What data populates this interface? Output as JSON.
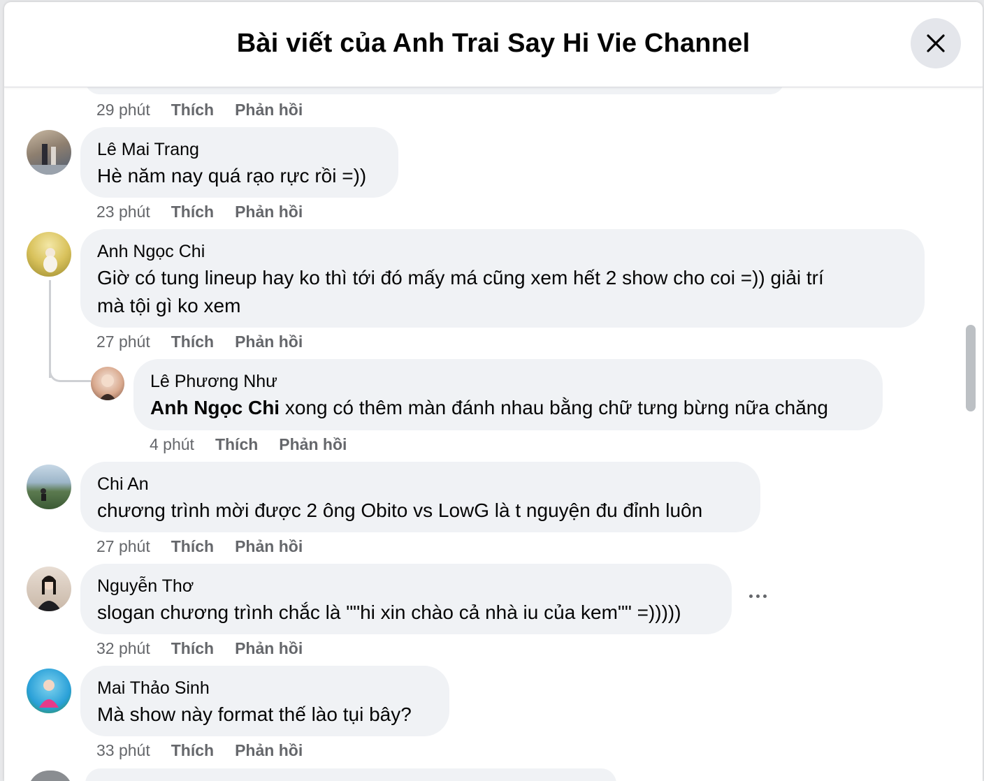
{
  "header": {
    "title": "Bài viết của Anh Trai Say Hi Vie Channel"
  },
  "actions": {
    "like": "Thích",
    "reply": "Phản hồi"
  },
  "top_meta": {
    "time": "29 phút"
  },
  "comments": [
    {
      "author": "Lê Mai Trang",
      "text": "Hè năm nay quá rạo rực rồi =))",
      "time": "23 phút"
    },
    {
      "author": "Anh Ngọc Chi",
      "line1": "Giờ có tung lineup hay ko thì tới đó mấy má cũng xem hết 2 show cho coi =)) giải trí",
      "line2": "mà tội gì ko xem",
      "time": "27 phút"
    },
    {
      "author": "Lê Phương Như",
      "mention": "Anh Ngọc Chi",
      "text": " xong có thêm màn đánh nhau bằng chữ tưng bừng nữa chăng",
      "time": "4 phút"
    },
    {
      "author": "Chi An",
      "text": "chương trình mời được 2 ông Obito vs LowG là t nguyện đu đỉnh luôn",
      "time": "27 phút"
    },
    {
      "author": "Nguyễn Thơ",
      "text": "slogan chương trình chắc là \"\"hi xin chào cả nhà iu của kem\"\" =)))))",
      "time": "32 phút"
    },
    {
      "author": "Mai Thảo Sinh",
      "text": "Mà show này format thế lào tụi bây?",
      "time": "33 phút"
    }
  ],
  "colors": {
    "bubble": "#f0f2f5",
    "meta": "#65676b",
    "text": "#050505"
  }
}
